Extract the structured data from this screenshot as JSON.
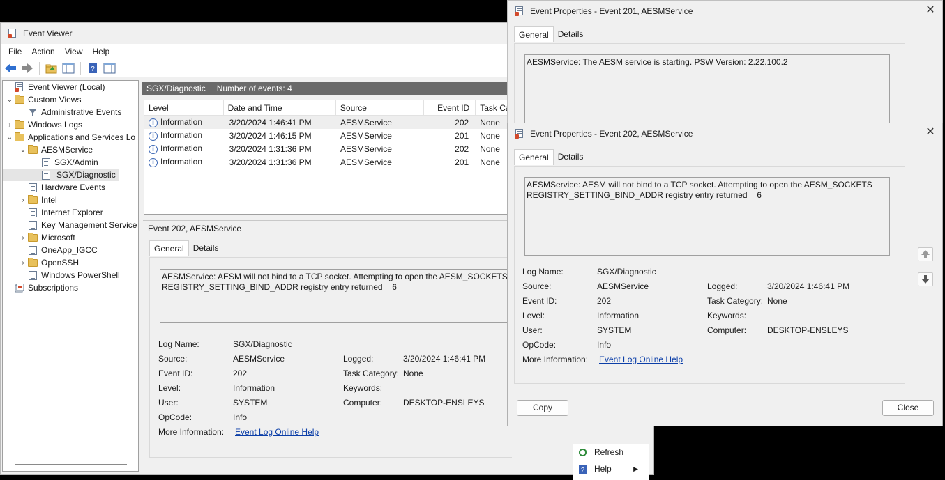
{
  "main": {
    "title": "Event Viewer",
    "menu": [
      "File",
      "Action",
      "View",
      "Help"
    ],
    "tree": [
      {
        "label": "Event Viewer (Local)",
        "level": 0,
        "arrow": "",
        "icon": "app"
      },
      {
        "label": "Custom Views",
        "level": 0,
        "arrow": "⌄",
        "icon": "folder"
      },
      {
        "label": "Administrative Events",
        "level": 1,
        "arrow": "",
        "icon": "filter"
      },
      {
        "label": "Windows Logs",
        "level": 0,
        "arrow": "›",
        "icon": "folder"
      },
      {
        "label": "Applications and Services Lo",
        "level": 0,
        "arrow": "⌄",
        "icon": "folder"
      },
      {
        "label": "AESMService",
        "level": 1,
        "arrow": "⌄",
        "icon": "folder"
      },
      {
        "label": "SGX/Admin",
        "level": 2,
        "arrow": "",
        "icon": "log"
      },
      {
        "label": "SGX/Diagnostic",
        "level": 2,
        "arrow": "",
        "icon": "log",
        "selected": true
      },
      {
        "label": "Hardware Events",
        "level": 1,
        "arrow": "",
        "icon": "log"
      },
      {
        "label": "Intel",
        "level": 1,
        "arrow": "›",
        "icon": "folder"
      },
      {
        "label": "Internet Explorer",
        "level": 1,
        "arrow": "",
        "icon": "log"
      },
      {
        "label": "Key Management Service",
        "level": 1,
        "arrow": "",
        "icon": "log"
      },
      {
        "label": "Microsoft",
        "level": 1,
        "arrow": "›",
        "icon": "folder"
      },
      {
        "label": "OneApp_IGCC",
        "level": 1,
        "arrow": "",
        "icon": "log"
      },
      {
        "label": "OpenSSH",
        "level": 1,
        "arrow": "›",
        "icon": "folder"
      },
      {
        "label": "Windows PowerShell",
        "level": 1,
        "arrow": "",
        "icon": "log"
      },
      {
        "label": "Subscriptions",
        "level": 0,
        "arrow": "",
        "icon": "subs"
      }
    ],
    "center_title": "SGX/Diagnostic",
    "event_count": "Number of events: 4",
    "columns": [
      "Level",
      "Date and Time",
      "Source",
      "Event ID",
      "Task Ca"
    ],
    "events": [
      {
        "level": "Information",
        "datetime": "3/20/2024 1:46:41 PM",
        "source": "AESMService",
        "id": "202",
        "task": "None"
      },
      {
        "level": "Information",
        "datetime": "3/20/2024 1:46:15 PM",
        "source": "AESMService",
        "id": "201",
        "task": "None"
      },
      {
        "level": "Information",
        "datetime": "3/20/2024 1:31:36 PM",
        "source": "AESMService",
        "id": "202",
        "task": "None"
      },
      {
        "level": "Information",
        "datetime": "3/20/2024 1:31:36 PM",
        "source": "AESMService",
        "id": "201",
        "task": "None"
      }
    ],
    "detail": {
      "title": "Event 202, AESMService",
      "tabs": [
        "General",
        "Details"
      ],
      "message": "AESMService: AESM will not bind to a TCP socket. Attempting to open the AESM_SOCKETS\nREGISTRY_SETTING_BIND_ADDR registry entry returned = 6",
      "log_name_label": "Log Name:",
      "log_name": "SGX/Diagnostic",
      "source_label": "Source:",
      "source": "AESMService",
      "logged_label": "Logged:",
      "logged": "3/20/2024 1:46:41 PM",
      "event_id_label": "Event ID:",
      "event_id": "202",
      "task_label": "Task Category:",
      "task": "None",
      "level_label": "Level:",
      "level": "Information",
      "keywords_label": "Keywords:",
      "user_label": "User:",
      "user": "SYSTEM",
      "computer_label": "Computer:",
      "computer": "DESKTOP-ENSLEYS",
      "opcode_label": "OpCode:",
      "opcode": "Info",
      "more_label": "More Information:",
      "more_link": "Event Log Online Help"
    },
    "actions": [
      {
        "label": "Refresh",
        "icon": "refresh-icon"
      },
      {
        "label": "Help",
        "icon": "help-icon"
      }
    ]
  },
  "prop201": {
    "title": "Event Properties - Event 201, AESMService",
    "tabs": [
      "General",
      "Details"
    ],
    "message": "AESMService: The AESM service is starting. PSW Version: 2.22.100.2"
  },
  "prop202": {
    "title": "Event Properties - Event 202, AESMService",
    "tabs": [
      "General",
      "Details"
    ],
    "message": "AESMService: AESM will not bind to a TCP socket. Attempting to open the AESM_SOCKETS\nREGISTRY_SETTING_BIND_ADDR registry entry returned = 6",
    "log_name_label": "Log Name:",
    "log_name": "SGX/Diagnostic",
    "source_label": "Source:",
    "source": "AESMService",
    "logged_label": "Logged:",
    "logged": "3/20/2024 1:46:41 PM",
    "event_id_label": "Event ID:",
    "event_id": "202",
    "task_label": "Task Category:",
    "task": "None",
    "level_label": "Level:",
    "level": "Information",
    "keywords_label": "Keywords:",
    "user_label": "User:",
    "user": "SYSTEM",
    "computer_label": "Computer:",
    "computer": "DESKTOP-ENSLEYS",
    "opcode_label": "OpCode:",
    "opcode": "Info",
    "more_label": "More Information:",
    "more_link": "Event Log Online Help",
    "copy_label": "Copy",
    "close_label": "Close"
  }
}
